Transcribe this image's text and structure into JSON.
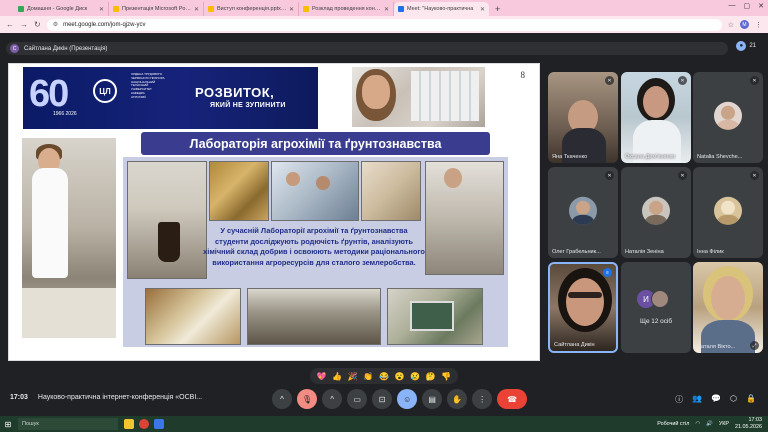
{
  "browser": {
    "tabs": [
      {
        "label": "Домашня - Google Диск",
        "color": "#34a853",
        "active": false
      },
      {
        "label": "Презентація Microsoft PowerP",
        "color": "#fbbc04",
        "active": false
      },
      {
        "label": "Виступ конференція.pptx - G",
        "color": "#fbbc04",
        "active": false
      },
      {
        "label": "Розклад проведення конфер",
        "color": "#fbbc04",
        "active": false
      },
      {
        "label": "Meet: \"Науково-практична",
        "color": "#1a73e8",
        "active": true
      }
    ],
    "new_tab": "+",
    "url": "meet.google.com/jom-qjzw-ycv",
    "profile_initial": "M"
  },
  "presenter": {
    "initial": "С",
    "label": "Сайтлана Дикін (Презентація)",
    "people_count": "21"
  },
  "slide": {
    "banner": {
      "big_number": "60",
      "years": "1966 2026",
      "logo_text": "ЦЛ",
      "mini_lines": [
        "ОРДЕНА ТРУДОВОГО",
        "ЧЕРВОНОГО ПРАПОРА",
        "НАЦІОНАЛЬНИЙ",
        "ТЕХНІЧНИЙ",
        "УНІВЕРСИТЕТ",
        "КАФЕДРА",
        "АГРОХІМІЇ"
      ],
      "headline": "РОЗВИТОК,",
      "subline": "ЯКИЙ НЕ ЗУПИНИТИ"
    },
    "page_number": "8",
    "title": "Лабораторія агрохімії та ґрунтознавства",
    "description": "У сучасній Лабораторії агрохімії та ґрунтознавства студенти досліджують родючість ґрунтів, аналізують хімічний склад добрив і освоюють методики раціонального використання агроресурсів для сталого землеробства."
  },
  "participants": [
    {
      "name": "Яна Ткаченко",
      "muted": true,
      "type": "video-a"
    },
    {
      "name": "Оксана Дем'яненко",
      "muted": true,
      "type": "video-b"
    },
    {
      "name": "Natalia Shevche...",
      "muted": true,
      "type": "avatar"
    },
    {
      "name": "Олег Грабельник...",
      "muted": true,
      "type": "avatar"
    },
    {
      "name": "Наталія Зеніна",
      "muted": true,
      "type": "avatar"
    },
    {
      "name": "Інна Філик",
      "muted": true,
      "type": "avatar"
    },
    {
      "name": "Сайтлана Дикін",
      "muted": false,
      "type": "video-e"
    },
    {
      "name": "Ще 12 осіб",
      "muted": false,
      "type": "more",
      "initial": "И"
    },
    {
      "name": "Наталя Вікто...",
      "muted": false,
      "type": "video-f"
    }
  ],
  "reactions": [
    "💖",
    "👍",
    "🎉",
    "👏",
    "😂",
    "😮",
    "😢",
    "🤔",
    "👎"
  ],
  "bottom": {
    "time": "17:03",
    "meeting_title": "Науково-практична інтернет-конференція «ОСВІ..."
  },
  "taskbar": {
    "search_placeholder": "Пошук",
    "weather": "Робочий стіл",
    "lang": "УКР",
    "clock_time": "17:03",
    "clock_date": "21.05.2026"
  },
  "colors": {
    "meet_bg": "#202124",
    "tile_bg": "#3c4043",
    "hangup": "#ea4335",
    "active_ctrl": "#8ab4f8",
    "slide_title": "#3a3d8f",
    "slide_text": "#1e2d8a"
  }
}
